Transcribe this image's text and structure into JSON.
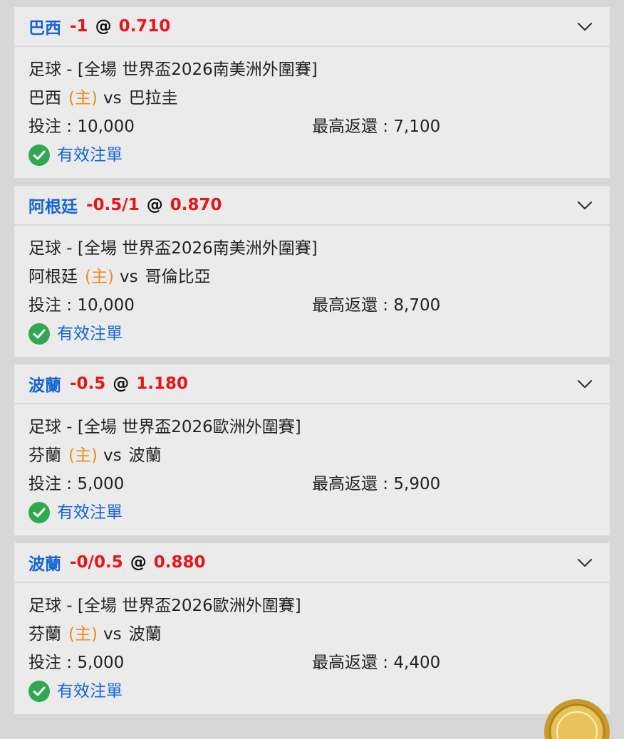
{
  "labels": {
    "stake_prefix": "投注 : ",
    "max_return_prefix": "最高返還 : ",
    "status": "有效注單",
    "home_marker": "(主)",
    "vs": "vs",
    "at": "@"
  },
  "colors": {
    "team": "#1565d8",
    "odds": "#e8141a",
    "home_marker": "#f08a1c",
    "status_icon": "#2fa84f"
  },
  "bets": [
    {
      "selection": "巴西",
      "handicap": "-1",
      "odds": "0.710",
      "event": "足球 - [全場 世界盃2026南美洲外圍賽]",
      "home": "巴西",
      "away": "巴拉圭",
      "stake": "10,000",
      "max_return": "7,100"
    },
    {
      "selection": "阿根廷",
      "handicap": "-0.5/1",
      "odds": "0.870",
      "event": "足球 - [全場 世界盃2026南美洲外圍賽]",
      "home": "阿根廷",
      "away": "哥倫比亞",
      "stake": "10,000",
      "max_return": "8,700"
    },
    {
      "selection": "波蘭",
      "handicap": "-0.5",
      "odds": "1.180",
      "event": "足球 - [全場 世界盃2026歐洲外圍賽]",
      "home": "芬蘭",
      "away": "波蘭",
      "stake": "5,000",
      "max_return": "5,900"
    },
    {
      "selection": "波蘭",
      "handicap": "-0/0.5",
      "odds": "0.880",
      "event": "足球 - [全場 世界盃2026歐洲外圍賽]",
      "home": "芬蘭",
      "away": "波蘭",
      "stake": "5,000",
      "max_return": "4,400"
    }
  ]
}
